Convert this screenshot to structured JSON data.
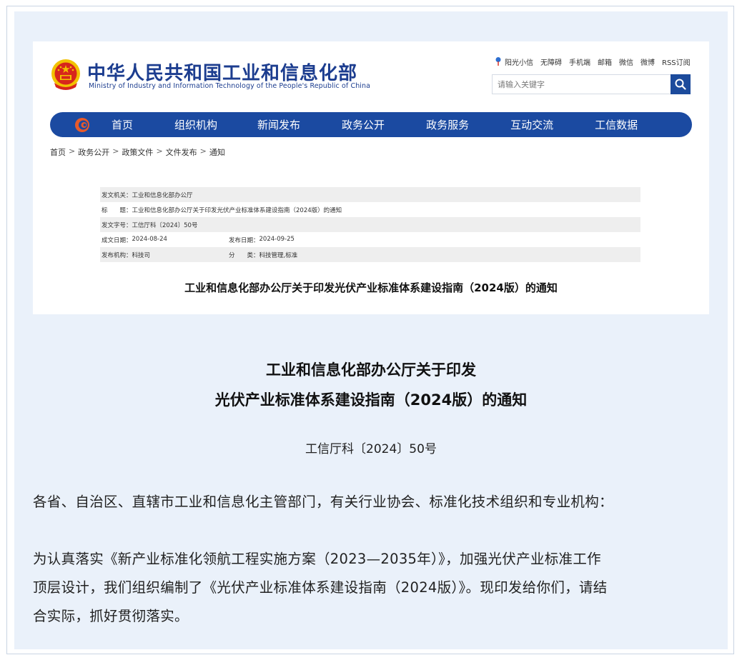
{
  "site": {
    "name_cn": "中华人民共和国工业和信息化部",
    "name_en": "Ministry of Industry and Information Technology of the People's Republic of China"
  },
  "toplinks": [
    "阳光小信",
    "无障碍",
    "手机端",
    "邮箱",
    "微信",
    "微博",
    "RSS订阅"
  ],
  "search": {
    "placeholder": "请输入关键字"
  },
  "nav": [
    "首页",
    "组织机构",
    "新闻发布",
    "政务公开",
    "政务服务",
    "互动交流",
    "工信数据"
  ],
  "breadcrumb": [
    "首页",
    "政务公开",
    "政策文件",
    "文件发布",
    "通知"
  ],
  "meta": {
    "issuer_label": "发文机关：",
    "issuer": "工业和信息化部办公厅",
    "title_label": "标　　题：",
    "title": "工业和信息化部办公厅关于印发光伏产业标准体系建设指南（2024版）的通知",
    "docno_label": "发文字号：",
    "docno": "工信厅科〔2024〕50号",
    "created_label": "成文日期：",
    "created": "2024-08-24",
    "published_label": "发布日期：",
    "published": "2024-09-25",
    "org_label": "发布机构：",
    "org": "科技司",
    "category_label": "分　　类：",
    "category": "科技管理,标准"
  },
  "card_title": "工业和信息化部办公厅关于印发光伏产业标准体系建设指南（2024版）的通知",
  "article": {
    "title_line1": "工业和信息化部办公厅关于印发",
    "title_line2": "光伏产业标准体系建设指南（2024版）的通知",
    "doc_number": "工信厅科〔2024〕50号",
    "addressee": "各省、自治区、直辖市工业和信息化主管部门，有关行业协会、标准化技术组织和专业机构：",
    "body_line1": "为认真落实《新产业标准化领航工程实施方案（2023—2035年）》，加强光伏产业标准工作",
    "body_line2": "顶层设计，我们组织编制了《光伏产业标准体系建设指南（2024版）》。现印发给你们，请结",
    "body_line3": "合实际，抓好贯彻落实。"
  },
  "colors": {
    "brand_blue": "#1b4aa1",
    "emblem_red": "#d7261c",
    "emblem_gold": "#f2c200"
  }
}
